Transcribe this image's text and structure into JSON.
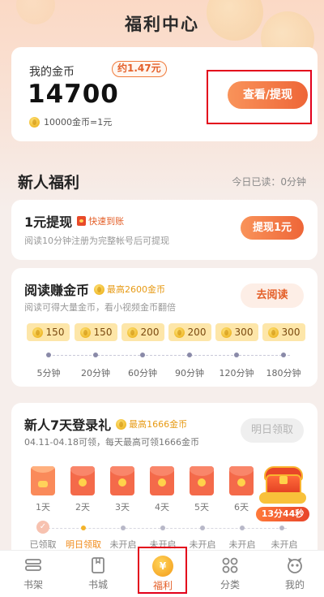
{
  "header": {
    "title": "福利中心"
  },
  "wallet": {
    "label": "我的金币",
    "approx": "约1.47元",
    "amount": "14700",
    "rate": "10000金币=1元",
    "button": "查看/提现"
  },
  "section": {
    "title": "新人福利",
    "read_today": "今日已读：0分钟"
  },
  "withdraw": {
    "title": "1元提现",
    "tag": "快速到账",
    "desc": "阅读10分钟注册为完整帐号后可提现",
    "button": "提现1元"
  },
  "read": {
    "title": "阅读赚金币",
    "tag": "最高2600金币",
    "desc": "阅读可得大量金币，看小视频金币翻倍",
    "button": "去阅读",
    "rewards": [
      "150",
      "150",
      "200",
      "200",
      "300",
      "300"
    ],
    "times": [
      "5分钟",
      "20分钟",
      "60分钟",
      "90分钟",
      "120分钟",
      "180分钟"
    ]
  },
  "login": {
    "title": "新人7天登录礼",
    "tag": "最高1666金币",
    "desc": "04.11-04.18可领，每天最高可领1666金币",
    "button": "明日领取",
    "days": [
      "1天",
      "2天",
      "3天",
      "4天",
      "5天",
      "6天"
    ],
    "statuses": [
      "已领取",
      "明日领取",
      "未开启",
      "未开启",
      "未开启",
      "未开启",
      "未开启"
    ]
  },
  "chest": {
    "timer": "13分44秒"
  },
  "tabs": [
    {
      "label": "书架",
      "icon": "bookshelf-icon"
    },
    {
      "label": "书城",
      "icon": "bookstore-icon"
    },
    {
      "label": "福利",
      "icon": "welfare-coin-icon"
    },
    {
      "label": "分类",
      "icon": "category-icon"
    },
    {
      "label": "我的",
      "icon": "profile-icon"
    }
  ],
  "colors": {
    "accent": "#ee6638",
    "highlight_box": "#e3001b"
  }
}
